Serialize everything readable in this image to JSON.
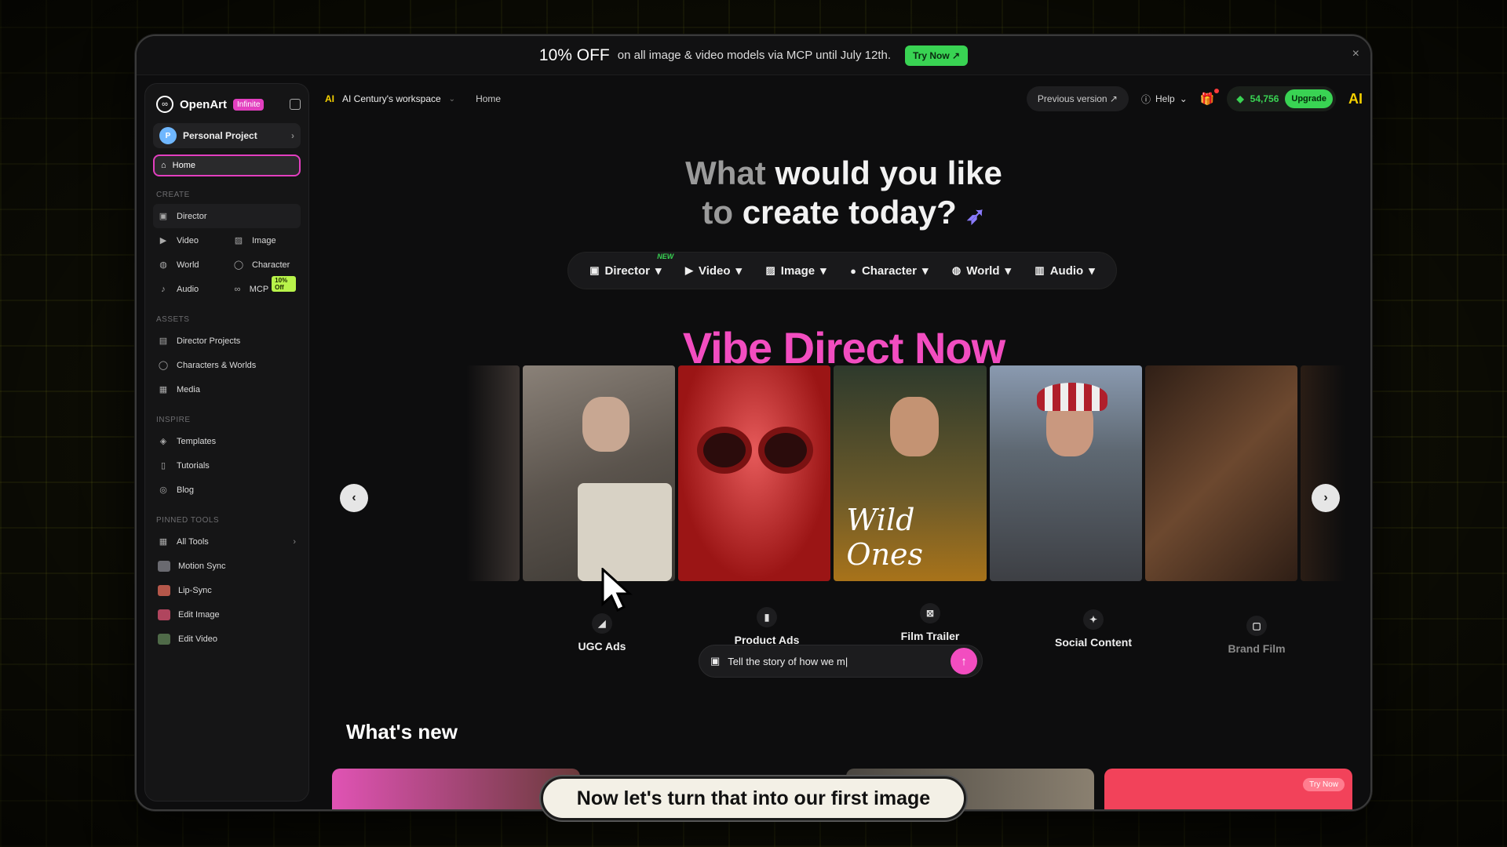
{
  "banner": {
    "big": "10% OFF",
    "small": "on all image & video models via MCP until July 12th.",
    "cta": "Try Now ↗",
    "close": "×"
  },
  "sidebar": {
    "brand": "OpenArt",
    "badge": "Infinite",
    "project_avatar": "P",
    "project": "Personal Project",
    "home": "Home",
    "create_label": "CREATE",
    "create_items": [
      {
        "label": "Director",
        "icon": "clapper-icon"
      },
      {
        "label": "Video",
        "icon": "video-icon"
      },
      {
        "label": "Image",
        "icon": "image-icon"
      },
      {
        "label": "World",
        "icon": "globe-icon"
      },
      {
        "label": "Character",
        "icon": "character-icon"
      },
      {
        "label": "Audio",
        "icon": "audio-icon"
      },
      {
        "label": "MCP",
        "icon": "link-icon",
        "badge": "10% Off"
      }
    ],
    "assets_label": "ASSETS",
    "assets_items": [
      "Director Projects",
      "Characters & Worlds",
      "Media"
    ],
    "inspire_label": "INSPIRE",
    "inspire_items": [
      "Templates",
      "Tutorials",
      "Blog"
    ],
    "pinned_label": "PINNED TOOLS",
    "pinned_items": [
      "All Tools",
      "Motion Sync",
      "Lip-Sync",
      "Edit Image",
      "Edit Video"
    ]
  },
  "topbar": {
    "ws_logo": "AI",
    "workspace": "AI Century's workspace",
    "crumb": "Home",
    "previous": "Previous version ↗",
    "help": "Help",
    "credits": "54,756",
    "upgrade": "Upgrade",
    "user": "AI"
  },
  "hero": {
    "line1_dim": "What",
    "line1_rest": " would you like",
    "line2_dim": "to",
    "line2_rest": " create today?"
  },
  "modes": [
    {
      "label": "Director",
      "icon": "clapper-icon",
      "new": "NEW"
    },
    {
      "label": "Video",
      "icon": "video-icon"
    },
    {
      "label": "Image",
      "icon": "image-icon"
    },
    {
      "label": "Character",
      "icon": "character-icon"
    },
    {
      "label": "World",
      "icon": "globe-icon"
    },
    {
      "label": "Audio",
      "icon": "audio-icon"
    }
  ],
  "vibe_title": "Vibe Direct Now",
  "carousel": {
    "items": [
      "UGC Ads",
      "Product Ads",
      "Film Trailer",
      "Social Content",
      "Brand Film"
    ],
    "film_overlay": "Wild Ones"
  },
  "prompt": {
    "value": "Tell the story of how we m|"
  },
  "whats_new": "What's new",
  "news_card_cta": "Try Now",
  "caption": "Now let's turn that into our first image",
  "colors": {
    "accent_pink": "#f24dc0",
    "accent_green": "#39d353",
    "badge_lime": "#b8f34a"
  }
}
